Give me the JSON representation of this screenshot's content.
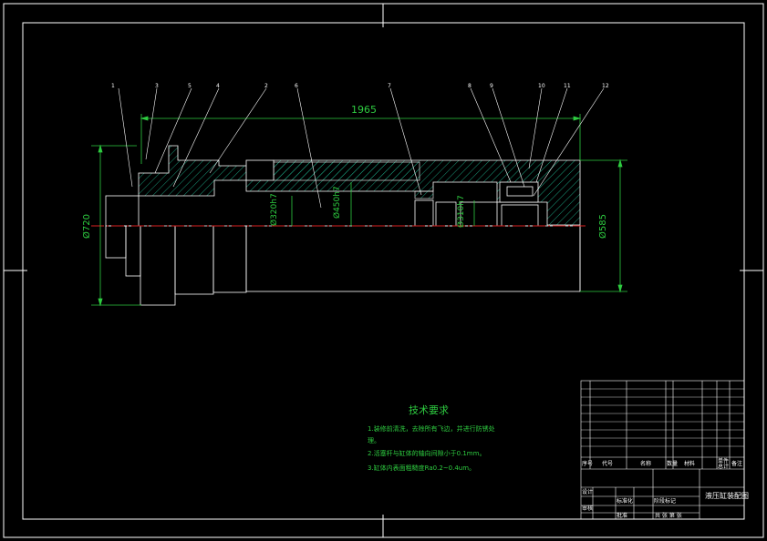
{
  "drawing": {
    "dimensions": {
      "overall_length": "1965",
      "dia_left": "Ø720",
      "dia_right": "Ø585",
      "dia_a": "Ø320h7",
      "dia_b": "Ø450h7",
      "dia_c": "Ø310h7"
    },
    "balloons": [
      "1",
      "3",
      "5",
      "4",
      "2",
      "6",
      "7",
      "8",
      "9",
      "10",
      "11",
      "12"
    ],
    "tech_requirements": {
      "title": "技术要求",
      "line1": "1.装修前清洗，去除所有飞边，并进行防锈处",
      "line1b": "理。",
      "line2": "2.活塞杆与缸体的轴向间隙小于0.1mm。",
      "line3": "3.缸体内表面粗糙度Ra0.2~0.4um。"
    },
    "title_block": {
      "name": "液压缸装配图",
      "seq_header": "序号",
      "code_header": "代号",
      "name_header": "名称",
      "qty_header": "数量",
      "material_header": "材料",
      "unit_weight_header": "单件",
      "total_weight_header": "总计",
      "remark_header": "备注",
      "design_label": "设计",
      "standard_label": "标准化",
      "stage_label": "阶段标记",
      "weight_label": "重量",
      "scale_label": "比例",
      "sheet_label": "共 张 第 张",
      "check_label": "审核",
      "approve_label": "批准"
    }
  }
}
